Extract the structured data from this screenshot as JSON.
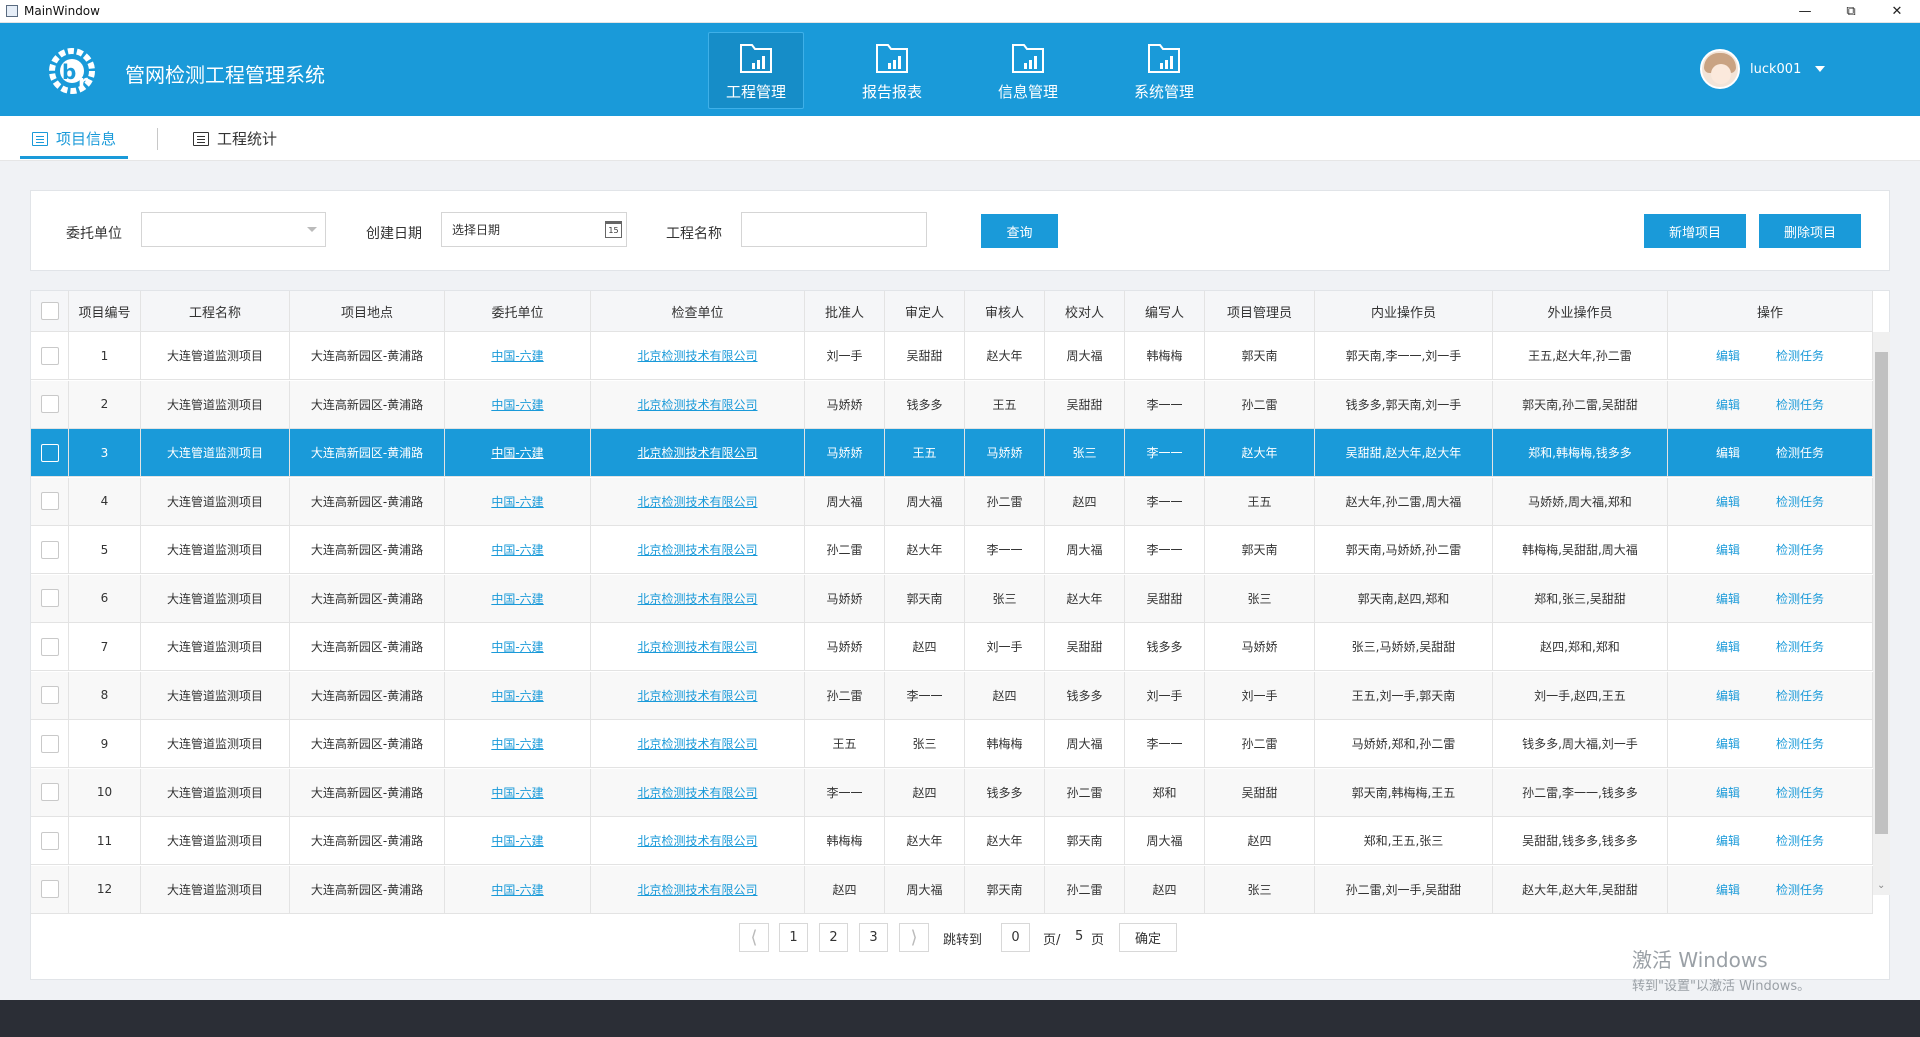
{
  "window": {
    "title": "MainWindow"
  },
  "header": {
    "app_title": "管网检测工程管理系统",
    "nav": [
      {
        "label": "工程管理",
        "active": true
      },
      {
        "label": "报告报表",
        "active": false
      },
      {
        "label": "信息管理",
        "active": false
      },
      {
        "label": "系统管理",
        "active": false
      }
    ],
    "user": {
      "name": "luck001"
    }
  },
  "subtabs": [
    {
      "label": "项目信息",
      "active": true
    },
    {
      "label": "工程统计",
      "active": false
    }
  ],
  "filters": {
    "client_label": "委托单位",
    "client_value": "",
    "date_label": "创建日期",
    "date_placeholder": "选择日期",
    "calendar_day": "15",
    "name_label": "工程名称",
    "name_value": "",
    "query_button": "查询",
    "add_button": "新增项目",
    "delete_button": "删除项目"
  },
  "table": {
    "headers": [
      "",
      "项目编号",
      "工程名称",
      "项目地点",
      "委托单位",
      "检查单位",
      "批准人",
      "审定人",
      "审核人",
      "校对人",
      "编写人",
      "项目管理员",
      "内业操作员",
      "外业操作员",
      "操作"
    ],
    "edit_label": "编辑",
    "task_label": "检测任务",
    "selected_row": 3,
    "rows": [
      {
        "id": "1",
        "name": "大连管道监测项目",
        "location": "大连高新园区-黄浦路",
        "client": "中国-六建",
        "inspector": "北京检测技术有限公司",
        "approver": "刘一手",
        "verifier": "吴甜甜",
        "reviewer": "赵大年",
        "checker": "周大福",
        "writer": "韩梅梅",
        "admin": "郭天南",
        "indoor": "郭天南,李一一,刘一手",
        "field": "王五,赵大年,孙二雷"
      },
      {
        "id": "2",
        "name": "大连管道监测项目",
        "location": "大连高新园区-黄浦路",
        "client": "中国-六建",
        "inspector": "北京检测技术有限公司",
        "approver": "马娇娇",
        "verifier": "钱多多",
        "reviewer": "王五",
        "checker": "吴甜甜",
        "writer": "李一一",
        "admin": "孙二雷",
        "indoor": "钱多多,郭天南,刘一手",
        "field": "郭天南,孙二雷,吴甜甜"
      },
      {
        "id": "3",
        "name": "大连管道监测项目",
        "location": "大连高新园区-黄浦路",
        "client": "中国-六建",
        "inspector": "北京检测技术有限公司",
        "approver": "马娇娇",
        "verifier": "王五",
        "reviewer": "马娇娇",
        "checker": "张三",
        "writer": "李一一",
        "admin": "赵大年",
        "indoor": "吴甜甜,赵大年,赵大年",
        "field": "郑和,韩梅梅,钱多多"
      },
      {
        "id": "4",
        "name": "大连管道监测项目",
        "location": "大连高新园区-黄浦路",
        "client": "中国-六建",
        "inspector": "北京检测技术有限公司",
        "approver": "周大福",
        "verifier": "周大福",
        "reviewer": "孙二雷",
        "checker": "赵四",
        "writer": "李一一",
        "admin": "王五",
        "indoor": "赵大年,孙二雷,周大福",
        "field": "马娇娇,周大福,郑和"
      },
      {
        "id": "5",
        "name": "大连管道监测项目",
        "location": "大连高新园区-黄浦路",
        "client": "中国-六建",
        "inspector": "北京检测技术有限公司",
        "approver": "孙二雷",
        "verifier": "赵大年",
        "reviewer": "李一一",
        "checker": "周大福",
        "writer": "李一一",
        "admin": "郭天南",
        "indoor": "郭天南,马娇娇,孙二雷",
        "field": "韩梅梅,吴甜甜,周大福"
      },
      {
        "id": "6",
        "name": "大连管道监测项目",
        "location": "大连高新园区-黄浦路",
        "client": "中国-六建",
        "inspector": "北京检测技术有限公司",
        "approver": "马娇娇",
        "verifier": "郭天南",
        "reviewer": "张三",
        "checker": "赵大年",
        "writer": "吴甜甜",
        "admin": "张三",
        "indoor": "郭天南,赵四,郑和",
        "field": "郑和,张三,吴甜甜"
      },
      {
        "id": "7",
        "name": "大连管道监测项目",
        "location": "大连高新园区-黄浦路",
        "client": "中国-六建",
        "inspector": "北京检测技术有限公司",
        "approver": "马娇娇",
        "verifier": "赵四",
        "reviewer": "刘一手",
        "checker": "吴甜甜",
        "writer": "钱多多",
        "admin": "马娇娇",
        "indoor": "张三,马娇娇,吴甜甜",
        "field": "赵四,郑和,郑和"
      },
      {
        "id": "8",
        "name": "大连管道监测项目",
        "location": "大连高新园区-黄浦路",
        "client": "中国-六建",
        "inspector": "北京检测技术有限公司",
        "approver": "孙二雷",
        "verifier": "李一一",
        "reviewer": "赵四",
        "checker": "钱多多",
        "writer": "刘一手",
        "admin": "刘一手",
        "indoor": "王五,刘一手,郭天南",
        "field": "刘一手,赵四,王五"
      },
      {
        "id": "9",
        "name": "大连管道监测项目",
        "location": "大连高新园区-黄浦路",
        "client": "中国-六建",
        "inspector": "北京检测技术有限公司",
        "approver": "王五",
        "verifier": "张三",
        "reviewer": "韩梅梅",
        "checker": "周大福",
        "writer": "李一一",
        "admin": "孙二雷",
        "indoor": "马娇娇,郑和,孙二雷",
        "field": "钱多多,周大福,刘一手"
      },
      {
        "id": "10",
        "name": "大连管道监测项目",
        "location": "大连高新园区-黄浦路",
        "client": "中国-六建",
        "inspector": "北京检测技术有限公司",
        "approver": "李一一",
        "verifier": "赵四",
        "reviewer": "钱多多",
        "checker": "孙二雷",
        "writer": "郑和",
        "admin": "吴甜甜",
        "indoor": "郭天南,韩梅梅,王五",
        "field": "孙二雷,李一一,钱多多"
      },
      {
        "id": "11",
        "name": "大连管道监测项目",
        "location": "大连高新园区-黄浦路",
        "client": "中国-六建",
        "inspector": "北京检测技术有限公司",
        "approver": "韩梅梅",
        "verifier": "赵大年",
        "reviewer": "赵大年",
        "checker": "郭天南",
        "writer": "周大福",
        "admin": "赵四",
        "indoor": "郑和,王五,张三",
        "field": "吴甜甜,钱多多,钱多多"
      },
      {
        "id": "12",
        "name": "大连管道监测项目",
        "location": "大连高新园区-黄浦路",
        "client": "中国-六建",
        "inspector": "北京检测技术有限公司",
        "approver": "赵四",
        "verifier": "周大福",
        "reviewer": "郭天南",
        "checker": "孙二雷",
        "writer": "赵四",
        "admin": "张三",
        "indoor": "孙二雷,刘一手,吴甜甜",
        "field": "赵大年,赵大年,吴甜甜"
      }
    ]
  },
  "pagination": {
    "pages": [
      "1",
      "2",
      "3"
    ],
    "jump_label": "跳转到",
    "jump_value": "0",
    "page_suffix": "页/",
    "total_pages": "5",
    "page_unit": "页",
    "confirm": "确定"
  },
  "watermark": {
    "line1": "激活 Windows",
    "line2": "转到\"设置\"以激活 Windows。"
  },
  "colors": {
    "primary": "#1a9ad9",
    "header_bg": "#1a9ad9",
    "bottom_bar": "#2b2e36"
  },
  "icons": {
    "nav_icon": "folder-chart-icon",
    "subtab_icon": "list-icon",
    "calendar_icon": "calendar-icon"
  }
}
